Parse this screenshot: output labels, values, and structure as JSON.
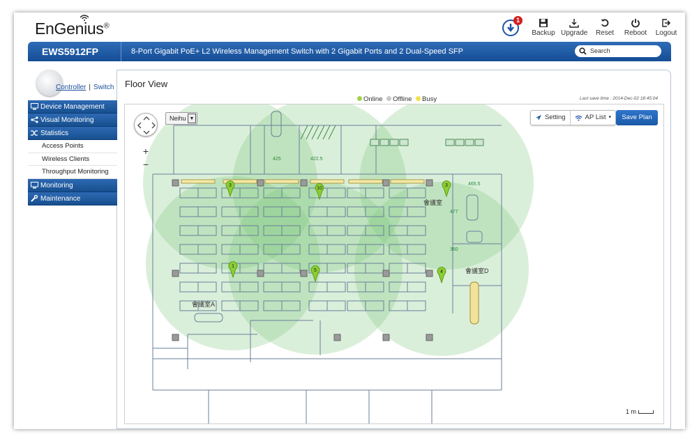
{
  "brand": {
    "name": "EnGenius"
  },
  "notifications": {
    "count": "1"
  },
  "toolbar": [
    {
      "id": "backup",
      "label": "Backup",
      "icon": "floppy-icon"
    },
    {
      "id": "upgrade",
      "label": "Upgrade",
      "icon": "download-icon"
    },
    {
      "id": "reset",
      "label": "Reset",
      "icon": "reset-icon"
    },
    {
      "id": "reboot",
      "label": "Reboot",
      "icon": "power-icon"
    },
    {
      "id": "logout",
      "label": "Logout",
      "icon": "logout-icon"
    }
  ],
  "header": {
    "model": "EWS5912FP",
    "product": "8-Port Gigabit PoE+ L2 Wireless Management Switch with 2 Gigabit Ports and 2 Dual-Speed SFP",
    "search_placeholder": "Search"
  },
  "mode": {
    "controller": "Controller",
    "separator": "|",
    "switch": "Switch"
  },
  "sidebar": [
    {
      "label": "Device Management",
      "icon": "monitor-icon",
      "type": "section"
    },
    {
      "label": "Visual Monitoring",
      "icon": "share-icon",
      "type": "section"
    },
    {
      "label": "Statistics",
      "icon": "shuffle-icon",
      "type": "section"
    },
    {
      "label": "Access Points",
      "type": "item"
    },
    {
      "label": "Wireless Clients",
      "type": "item"
    },
    {
      "label": "Throughput Monitoring",
      "type": "item"
    },
    {
      "label": "Monitoring",
      "icon": "monitor-icon",
      "type": "section"
    },
    {
      "label": "Maintenance",
      "icon": "wrench-icon",
      "type": "section"
    }
  ],
  "page": {
    "title": "Floor View",
    "legend": [
      {
        "label": "Online",
        "color": "#9fd34b"
      },
      {
        "label": "Offline",
        "color": "#c8c8c8"
      },
      {
        "label": "Busy",
        "color": "#f2e24a"
      }
    ],
    "last_save": "Last save time : 2014-Dec-02 18:45:04"
  },
  "map": {
    "floor_selected": "Neihu",
    "setting_label": "Setting",
    "ap_list_label": "AP List",
    "save_plan_label": "Save Plan",
    "scale_label": "1 m",
    "coverage_color": "#7bc77a",
    "ap_markers": [
      "3",
      "10",
      "3",
      "1",
      "5",
      "4"
    ],
    "room_labels": [
      "會議室A",
      "會議室",
      "會議室D"
    ],
    "dimension_labels": [
      "425",
      "422.5",
      "465.5",
      "477",
      "360"
    ]
  }
}
